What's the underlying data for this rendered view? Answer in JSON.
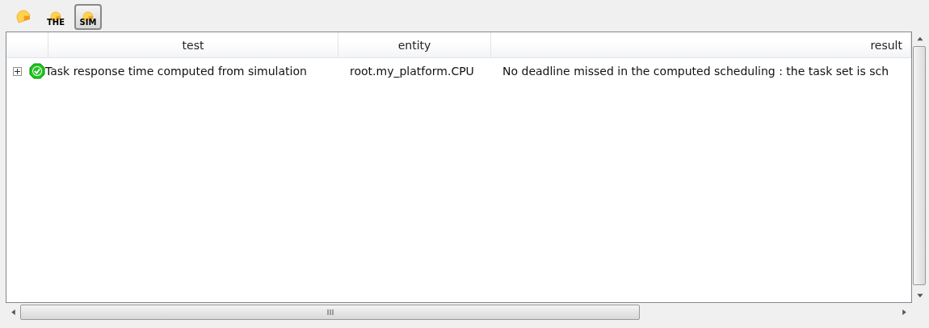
{
  "toolbar": [
    {
      "kind": "plain",
      "selected": false
    },
    {
      "kind": "tagged",
      "label": "THE",
      "selected": false
    },
    {
      "kind": "tagged",
      "label": "SIM",
      "selected": true
    }
  ],
  "table": {
    "columns": [
      "test",
      "entity",
      "result"
    ],
    "rows": [
      {
        "expanded": false,
        "passed": true,
        "cells": [
          "Task response time computed from simulation",
          "root.my_platform.CPU",
          "No deadline missed in the computed scheduling : the task set is sch"
        ]
      }
    ]
  }
}
